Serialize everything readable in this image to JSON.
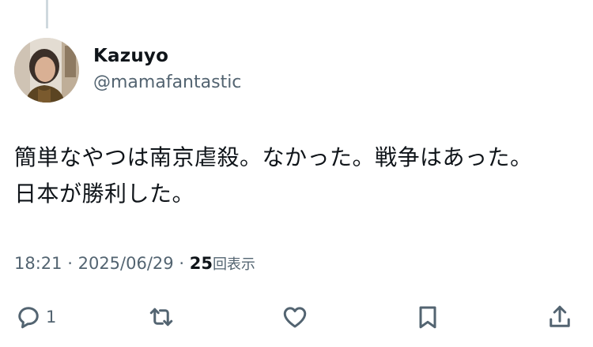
{
  "tweet": {
    "author_name": "Kazuyo",
    "author_handle": "@mamafantastic",
    "text_line_1": "簡単なやつは南京虐殺。なかった。戦争はあった。",
    "text_line_2": "日本が勝利した。",
    "time": "18:21",
    "date": "2025/06/29",
    "separator": "·",
    "views_count": "25",
    "views_label": "回表示"
  },
  "actions": {
    "reply_count": "1",
    "reply_icon": "speech-bubble-icon",
    "retweet_icon": "retweet-arrows-icon",
    "like_icon": "heart-icon",
    "bookmark_icon": "bookmark-icon",
    "share_icon": "share-upload-icon"
  },
  "colors": {
    "text_primary": "#0f1419",
    "text_secondary": "#536471",
    "thread_line": "#cfd9de",
    "background": "#ffffff"
  }
}
